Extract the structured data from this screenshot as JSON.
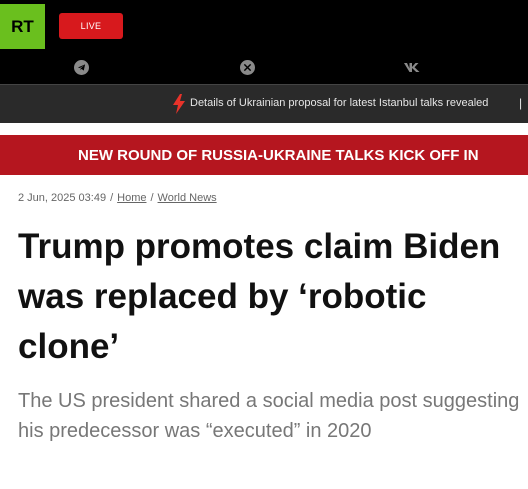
{
  "header": {
    "logo_text": "RT",
    "live_label": "LIVE",
    "brand_color": "#6abf1e",
    "live_color": "#d7191d",
    "social_icons": [
      "telegram-icon",
      "x-icon",
      "vk-icon"
    ]
  },
  "ticker": {
    "icon": "lightning-bolt-icon",
    "text": "Details of Ukrainian proposal for latest Istanbul talks revealed",
    "separator": "|"
  },
  "breaking": {
    "text": "NEW ROUND OF RUSSIA-UKRAINE TALKS KICK OFF IN",
    "color": "#b5161f"
  },
  "article": {
    "timestamp": "2 Jun, 2025 03:49",
    "breadcrumb": [
      "Home",
      "World News"
    ],
    "title": "Trump promotes claim Biden was replaced by ‘robotic clone’",
    "summary": "The US president shared a social media post suggesting his predecessor was “executed” in 2020"
  }
}
